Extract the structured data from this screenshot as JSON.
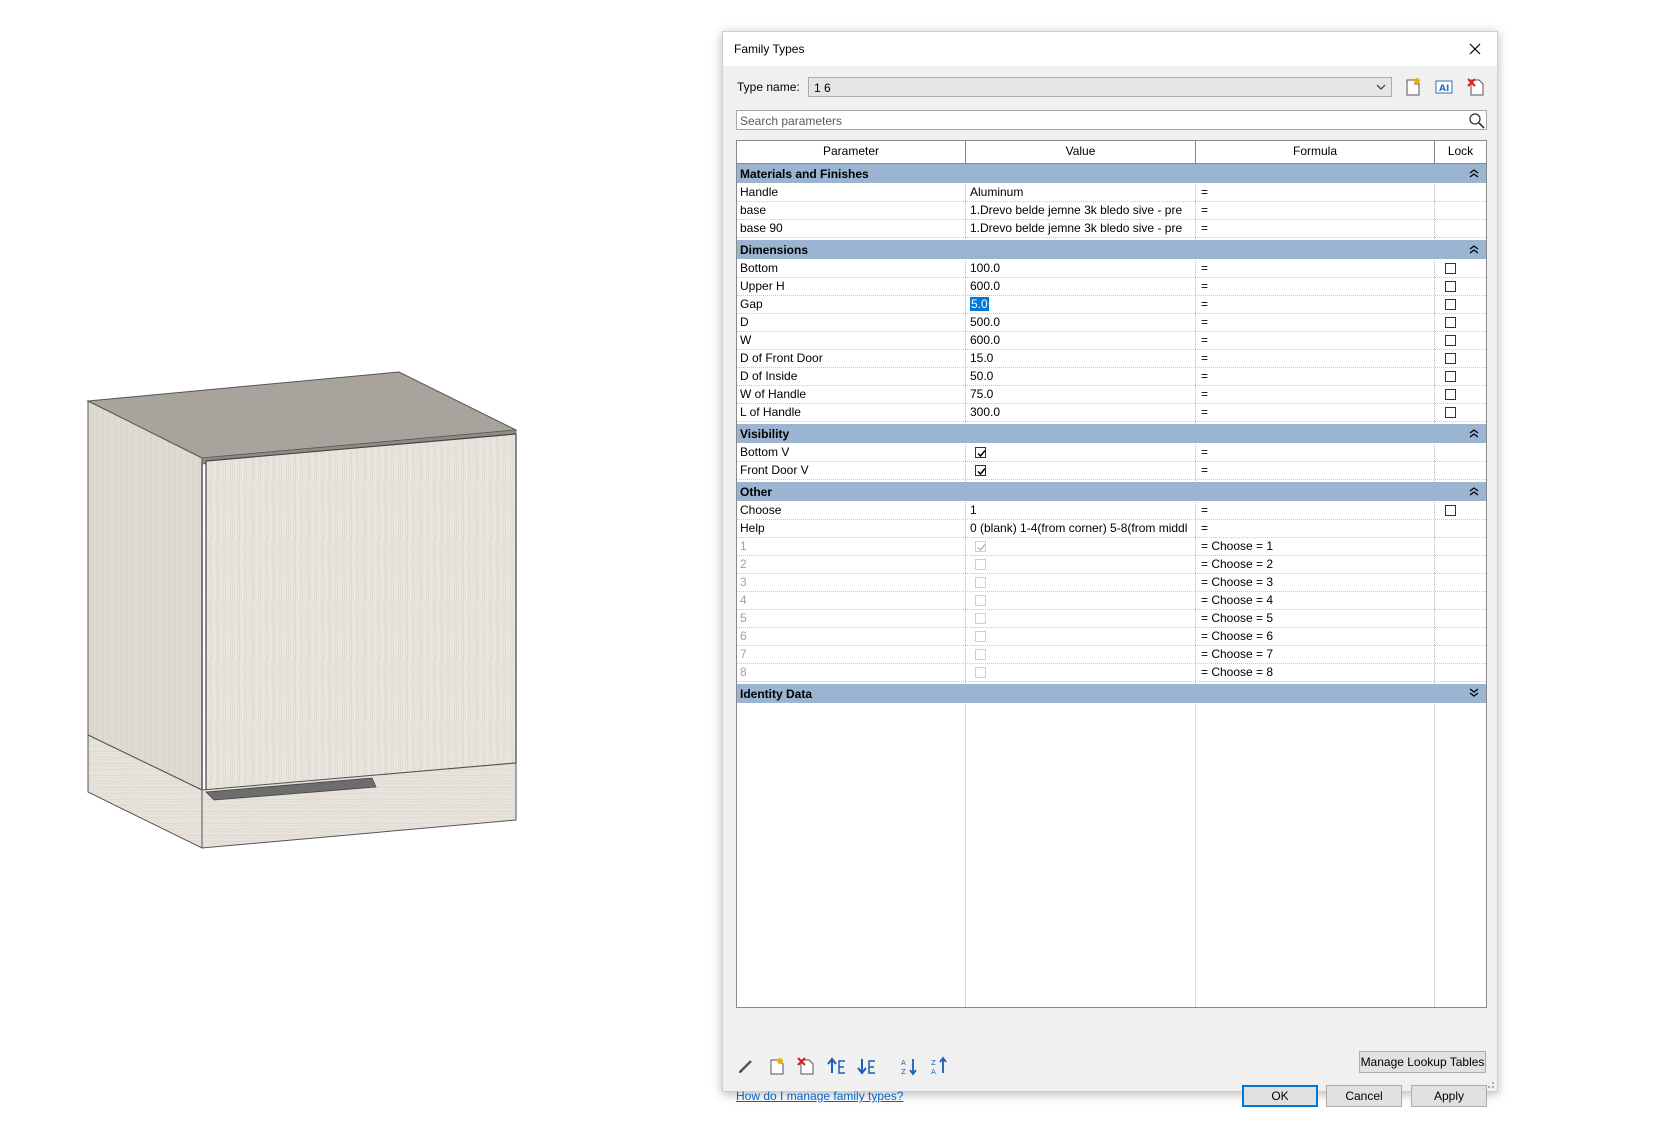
{
  "dialog": {
    "title": "Family Types",
    "type_name_label": "Type name:",
    "type_name_value": "1 6",
    "search_placeholder": "Search parameters",
    "help_link": "How do I manage family types?",
    "buttons": {
      "manage_lookup": "Manage Lookup Tables",
      "ok": "OK",
      "cancel": "Cancel",
      "apply": "Apply"
    }
  },
  "columns": [
    "Parameter",
    "Value",
    "Formula",
    "Lock"
  ],
  "groups": [
    {
      "title": "Materials and Finishes",
      "collapsed": false,
      "rows": [
        {
          "param": "Handle",
          "value": "Aluminum",
          "formula": "="
        },
        {
          "param": "base",
          "value": "1.Drevo belde jemne 3k bledo sive - pre",
          "formula": "="
        },
        {
          "param": "base 90",
          "value": "1.Drevo belde jemne 3k bledo sive - pre",
          "formula": "="
        }
      ]
    },
    {
      "title": "Dimensions",
      "collapsed": false,
      "rows": [
        {
          "param": "Bottom",
          "value": "100.0",
          "formula": "=",
          "lock": false
        },
        {
          "param": "Upper H",
          "value": "600.0",
          "formula": "=",
          "lock": false
        },
        {
          "param": "Gap",
          "value": "5.0",
          "formula": "=",
          "lock": false,
          "selected": true
        },
        {
          "param": "D",
          "value": "500.0",
          "formula": "=",
          "lock": false
        },
        {
          "param": "W",
          "value": "600.0",
          "formula": "=",
          "lock": false
        },
        {
          "param": "D of Front Door",
          "value": "15.0",
          "formula": "=",
          "lock": false
        },
        {
          "param": "D of Inside",
          "value": "50.0",
          "formula": "=",
          "lock": false
        },
        {
          "param": "W of Handle",
          "value": "75.0",
          "formula": "=",
          "lock": false
        },
        {
          "param": "L of Handle",
          "value": "300.0",
          "formula": "=",
          "lock": false
        }
      ]
    },
    {
      "title": "Visibility",
      "collapsed": false,
      "rows": [
        {
          "param": "Bottom V",
          "checkbox": true,
          "formula": "="
        },
        {
          "param": "Front Door V",
          "checkbox": true,
          "formula": "="
        }
      ]
    },
    {
      "title": "Other",
      "collapsed": false,
      "rows": [
        {
          "param": "Choose",
          "value": "1",
          "formula": "=",
          "lock": false
        },
        {
          "param": "Help",
          "value": "0 (blank) 1-4(from corner) 5-8(from middl",
          "formula": "="
        },
        {
          "param": "1",
          "checkbox": true,
          "disabled": true,
          "formula": "= Choose = 1"
        },
        {
          "param": "2",
          "checkbox": false,
          "disabled": true,
          "formula": "= Choose = 2"
        },
        {
          "param": "3",
          "checkbox": false,
          "disabled": true,
          "formula": "= Choose = 3"
        },
        {
          "param": "4",
          "checkbox": false,
          "disabled": true,
          "formula": "= Choose = 4"
        },
        {
          "param": "5",
          "checkbox": false,
          "disabled": true,
          "formula": "= Choose = 5"
        },
        {
          "param": "6",
          "checkbox": false,
          "disabled": true,
          "formula": "= Choose = 6"
        },
        {
          "param": "7",
          "checkbox": false,
          "disabled": true,
          "formula": "= Choose = 7"
        },
        {
          "param": "8",
          "checkbox": false,
          "disabled": true,
          "formula": "= Choose = 8"
        }
      ]
    },
    {
      "title": "Identity Data",
      "collapsed": true,
      "rows": []
    }
  ],
  "toolbar_icons": [
    "pencil-icon",
    "new-parameter-icon",
    "delete-parameter-icon",
    "move-up-icon",
    "move-down-icon",
    "sort-ascending-icon",
    "sort-descending-icon"
  ],
  "type_icons": [
    "new-type-icon",
    "rename-type-icon",
    "delete-type-icon"
  ],
  "colors": {
    "group_header": "#9ab4d1",
    "link": "#0066cc",
    "selection": "#0078d7",
    "cabinet_front": "#e9e4dd",
    "cabinet_top": "#a7a29c"
  }
}
